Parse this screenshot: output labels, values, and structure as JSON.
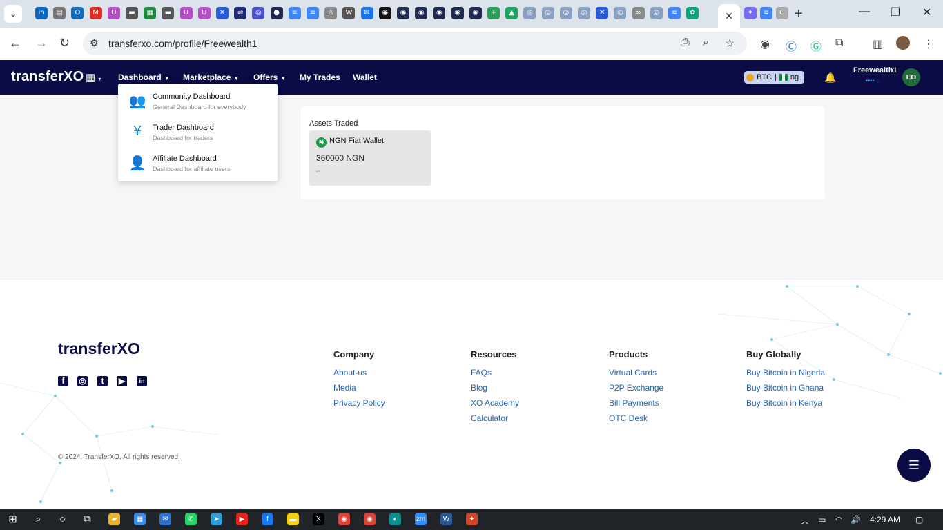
{
  "browser": {
    "url": "transferxo.com/profile/Freewealth1",
    "active_tab_close": "✕",
    "new_tab": "+",
    "tab_icons": [
      {
        "name": "linkedin-tab-icon",
        "glyph": "in",
        "color": "#0a66c2"
      },
      {
        "name": "tab-icon-2",
        "glyph": "▤",
        "color": "#777"
      },
      {
        "name": "outlook-tab-icon",
        "glyph": "O",
        "color": "#0f6cbd"
      },
      {
        "name": "gmail-tab-icon",
        "glyph": "M",
        "color": "#d93025"
      },
      {
        "name": "tab-icon-5",
        "glyph": "U",
        "color": "#b44fc7"
      },
      {
        "name": "tab-icon-6",
        "glyph": "▬",
        "color": "#555"
      },
      {
        "name": "tab-icon-7",
        "glyph": "▦",
        "color": "#1a8a3a"
      },
      {
        "name": "tab-icon-8",
        "glyph": "▬",
        "color": "#555"
      },
      {
        "name": "tab-icon-9",
        "glyph": "U",
        "color": "#b44fc7"
      },
      {
        "name": "tab-icon-10",
        "glyph": "U",
        "color": "#b44fc7"
      },
      {
        "name": "tab-icon-11",
        "glyph": "✕",
        "color": "#2a5bd7"
      },
      {
        "name": "tab-icon-12",
        "glyph": "⇌",
        "color": "#1e2a78"
      },
      {
        "name": "tab-icon-13",
        "glyph": "◎",
        "color": "#4b4fc9"
      },
      {
        "name": "tab-icon-14",
        "glyph": "●",
        "color": "#1e2a50"
      },
      {
        "name": "docs-tab-icon",
        "glyph": "≡",
        "color": "#4285f4"
      },
      {
        "name": "docs-tab-icon-2",
        "glyph": "≡",
        "color": "#4285f4"
      },
      {
        "name": "tab-icon-17",
        "glyph": "♙",
        "color": "#888"
      },
      {
        "name": "tab-icon-18",
        "glyph": "W",
        "color": "#555"
      },
      {
        "name": "mail-tab-icon",
        "glyph": "✉",
        "color": "#1a73e8"
      },
      {
        "name": "tab-icon-20",
        "glyph": "◉",
        "color": "#111"
      },
      {
        "name": "tab-icon-21",
        "glyph": "◉",
        "color": "#1e2a50"
      },
      {
        "name": "tab-icon-22",
        "glyph": "◉",
        "color": "#1e2a50"
      },
      {
        "name": "tab-icon-23",
        "glyph": "◉",
        "color": "#1e2a50"
      },
      {
        "name": "tab-icon-24",
        "glyph": "◉",
        "color": "#1e2a50"
      },
      {
        "name": "tab-icon-25",
        "glyph": "◉",
        "color": "#1e2a50"
      },
      {
        "name": "tab-icon-26",
        "glyph": "+",
        "color": "#2e9d5a"
      },
      {
        "name": "drive-tab-icon",
        "glyph": "▲",
        "color": "#1fa463"
      },
      {
        "name": "tab-icon-28",
        "glyph": "◎",
        "color": "#8aa0c0"
      },
      {
        "name": "tab-icon-29",
        "glyph": "◎",
        "color": "#8aa0c0"
      },
      {
        "name": "tab-icon-30",
        "glyph": "◎",
        "color": "#8aa0c0"
      },
      {
        "name": "tab-icon-31",
        "glyph": "◎",
        "color": "#8aa0c0"
      },
      {
        "name": "tab-icon-32",
        "glyph": "✕",
        "color": "#2a5bd7"
      },
      {
        "name": "tab-icon-33",
        "glyph": "◎",
        "color": "#8aa0c0"
      },
      {
        "name": "meta-tab-icon",
        "glyph": "∞",
        "color": "#888"
      },
      {
        "name": "tab-icon-35",
        "glyph": "◎",
        "color": "#8aa0c0"
      },
      {
        "name": "docs-tab-icon-3",
        "glyph": "≡",
        "color": "#4285f4"
      },
      {
        "name": "chatgpt-tab-icon",
        "glyph": "✿",
        "color": "#10a37f"
      }
    ],
    "after_tabs": [
      {
        "name": "gemini-tab-icon",
        "glyph": "✦",
        "color": "#7a6cf0"
      },
      {
        "name": "docs-tab-icon-4",
        "glyph": "≡",
        "color": "#4285f4"
      },
      {
        "name": "google-tab-icon",
        "glyph": "G",
        "color": "#aaa"
      }
    ]
  },
  "site": {
    "logo_text": "transfer",
    "logo_x": "XO",
    "nav": {
      "dashboard": "Dashboard",
      "marketplace": "Marketplace",
      "offers": "Offers",
      "my_trades": "My Trades",
      "wallet": "Wallet"
    },
    "currency_pill": {
      "coin": "BTC",
      "sep": "|",
      "country": "ng"
    },
    "username": "Freewealth1",
    "user_status": "•••• ◌",
    "avatar_initials": "EO"
  },
  "dropdown": {
    "items": [
      {
        "title": "Community Dashboard",
        "subtitle": "General Dashboard for everybody",
        "icon": "community-icon",
        "glyph": "👥"
      },
      {
        "title": "Trader Dashboard",
        "subtitle": "Dashboard for traders",
        "icon": "trader-icon",
        "glyph": "¥"
      },
      {
        "title": "Affiliate Dashboard",
        "subtitle": "Dashboard for affiliate users",
        "icon": "affiliate-icon",
        "glyph": "👤"
      }
    ]
  },
  "main": {
    "assets_label": "Assets Traded",
    "asset": {
      "name": "NGN Fiat Wallet",
      "value": "360000 NGN",
      "sub": "--",
      "icon_glyph": "₦"
    }
  },
  "footer": {
    "company": {
      "title": "Company",
      "links": [
        "About-us",
        "Media",
        "Privacy Policy"
      ]
    },
    "resources": {
      "title": "Resources",
      "links": [
        "FAQs",
        "Blog",
        "XO Academy",
        "Calculator"
      ]
    },
    "products": {
      "title": "Products",
      "links": [
        "Virtual Cards",
        "P2P Exchange",
        "Bill Payments",
        "OTC Desk"
      ]
    },
    "buy_globally": {
      "title": "Buy Globally",
      "links": [
        "Buy Bitcoin in Nigeria",
        "Buy Bitcoin in Ghana",
        "Buy Bitcoin in Kenya"
      ]
    },
    "copyright": "© 2024, TransferXO. All rights reserved.",
    "social": [
      "f",
      "◎",
      "t",
      "▶",
      "in"
    ]
  },
  "taskbar": {
    "time": "4:29 AM",
    "apps": [
      {
        "name": "windows-start-icon",
        "glyph": "⊞",
        "color": "transparent"
      },
      {
        "name": "search-taskbar-icon",
        "glyph": "⌕",
        "color": "transparent"
      },
      {
        "name": "cortana-icon",
        "glyph": "○",
        "color": "transparent"
      },
      {
        "name": "task-view-icon",
        "glyph": "⧉",
        "color": "transparent"
      },
      {
        "name": "file-explorer-icon",
        "glyph": "▰",
        "color": "#e8b32a"
      },
      {
        "name": "store-icon",
        "glyph": "▦",
        "color": "#3a8ae8"
      },
      {
        "name": "mail-app-icon",
        "glyph": "✉",
        "color": "#2a73d0"
      },
      {
        "name": "whatsapp-icon",
        "glyph": "✆",
        "color": "#25d366"
      },
      {
        "name": "telegram-icon",
        "glyph": "➤",
        "color": "#2aa1dc"
      },
      {
        "name": "youtube-icon",
        "glyph": "▶",
        "color": "#e62117"
      },
      {
        "name": "facebook-icon",
        "glyph": "f",
        "color": "#1877f2"
      },
      {
        "name": "sticky-notes-icon",
        "glyph": "▬",
        "color": "#f6d10a"
      },
      {
        "name": "x-app-icon",
        "glyph": "X",
        "color": "#000"
      },
      {
        "name": "chrome-icon",
        "glyph": "◉",
        "color": "#db4437"
      },
      {
        "name": "chrome-icon-2",
        "glyph": "◉",
        "color": "#db4437"
      },
      {
        "name": "edge-icon",
        "glyph": "◐",
        "color": "#0c8f8f"
      },
      {
        "name": "zoom-icon",
        "glyph": "zm",
        "color": "#2d8cff"
      },
      {
        "name": "word-icon",
        "glyph": "W",
        "color": "#2b5797"
      },
      {
        "name": "app-icon-last",
        "glyph": "✦",
        "color": "#d24726"
      }
    ]
  }
}
